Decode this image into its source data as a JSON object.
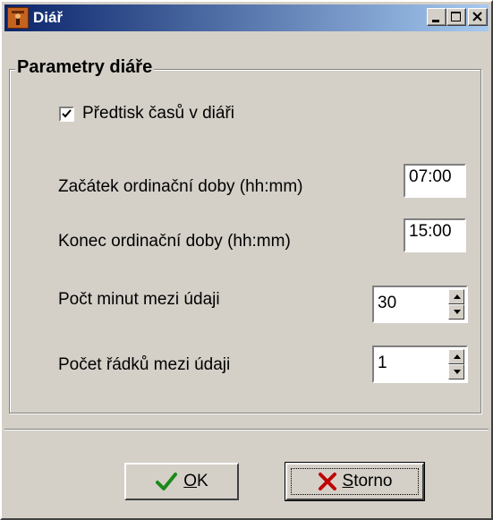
{
  "window": {
    "title": "Diář",
    "icon": "app-icon",
    "controls": [
      "minimize-icon",
      "maximize-icon",
      "close-icon"
    ]
  },
  "group": {
    "title": "Parametry diáře",
    "preprint": {
      "label": "Předtisk časů v diáři",
      "checked": true
    },
    "start": {
      "label": "Začátek ordinační doby (hh:mm)",
      "value": "07:00"
    },
    "end": {
      "label": "Konec ordinační doby (hh:mm)",
      "value": "15:00"
    },
    "minutes": {
      "label": "Počt minut mezi údaji",
      "value": "30"
    },
    "rows": {
      "label": "Počet řádků mezi údaji",
      "value": "1"
    }
  },
  "buttons": {
    "ok": {
      "label_underlined": "O",
      "label_rest": "K",
      "icon": "checkmark-icon"
    },
    "cancel": {
      "label_underlined": "S",
      "label_rest": "torno",
      "icon": "x-icon"
    }
  },
  "colors": {
    "face": "#d4d0c8",
    "title_start": "#0a246a",
    "title_end": "#a6caf0",
    "ok_check": "#1a8a1a",
    "cancel_x": "#c00000"
  }
}
